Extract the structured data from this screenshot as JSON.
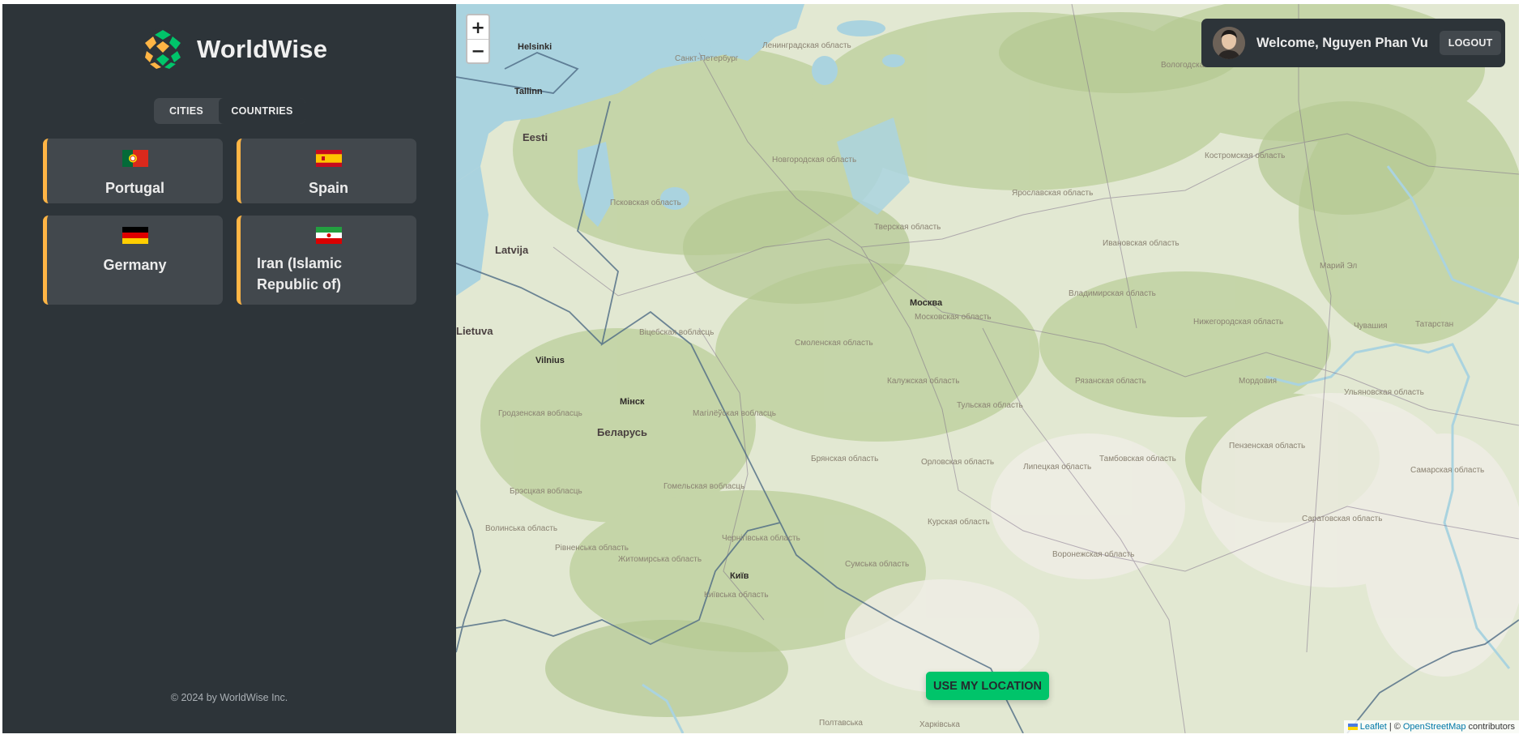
{
  "app": {
    "name": "WorldWise",
    "footer": "© 2024 by WorldWise Inc."
  },
  "tabs": [
    {
      "label": "CITIES",
      "active": false
    },
    {
      "label": "COUNTRIES",
      "active": true
    }
  ],
  "countries": [
    {
      "name": "Portugal",
      "flag": "portugal-flag-icon"
    },
    {
      "name": "Spain",
      "flag": "spain-flag-icon"
    },
    {
      "name": "Germany",
      "flag": "germany-flag-icon"
    },
    {
      "name": "Iran (Islamic Republic of)",
      "flag": "iran-flag-icon"
    }
  ],
  "user": {
    "welcome": "Welcome, Nguyen Phan Vu",
    "logout_label": "LOGOUT"
  },
  "map": {
    "zoom_in": "+",
    "zoom_out": "−",
    "location_button": "USE MY LOCATION",
    "attribution": {
      "leaflet": "Leaflet",
      "separator": "| ©",
      "osm": "OpenStreetMap",
      "suffix": "contributors"
    },
    "labels": {
      "helsinki": "Helsinki",
      "tallinn": "Tallinn",
      "eesti": "Eesti",
      "latvija": "Latvija",
      "lietuva": "Lietuva",
      "vilnius": "Vilnius",
      "minsk": "Мінск",
      "belarus": "Беларусь",
      "moskva": "Москва",
      "kyiv": "Київ",
      "spb": "Санкт-Петербург",
      "leningrad": "Ленинградская область",
      "pskov": "Псковская область",
      "novgorod": "Новгородская область",
      "tver": "Тверская область",
      "yaroslavl": "Ярославская область",
      "kostroma": "Костромская область",
      "vologda": "Вологодская область",
      "ivanovo": "Ивановская область",
      "vladimir": "Владимирская область",
      "moscow_obl": "Московская область",
      "smolensk": "Смоленская область",
      "kaluga": "Калужская область",
      "tula": "Тульская область",
      "ryazan": "Рязанская область",
      "nizhny": "Нижегородская область",
      "mari": "Марий Эл",
      "chuvash": "Чувашия",
      "tatarstan": "Татарстан",
      "mordovia": "Мордовия",
      "ulyanovsk": "Ульяновская область",
      "penza": "Пензенская область",
      "samara": "Самарская область",
      "saratov": "Саратовская область",
      "tambov": "Тамбовская область",
      "lipetsk": "Липецкая область",
      "orel": "Орловская область",
      "bryansk": "Брянская область",
      "kursk": "Курская область",
      "voronezh": "Воронежская область",
      "vitebsk": "Віцебская вобласць",
      "grodno": "Гродзенская вобласць",
      "mogilev": "Магілёўская вобласць",
      "brest": "Брэсцкая вобласць",
      "gomel": "Гомельская вобласць",
      "volyn": "Волинська область",
      "rivne": "Рівненська область",
      "zhytomyr": "Житомирська область",
      "chernihiv": "Чернігівська область",
      "sumy": "Сумська область",
      "kyiv_obl": "Київська область",
      "poltava": "Полтавська",
      "kharkiv": "Харківська"
    }
  },
  "colors": {
    "sidebar_bg": "#2d3439",
    "card_bg": "#42484d",
    "accent_orange": "#ffb545",
    "accent_green": "#00c46a",
    "map_water": "#aad3df",
    "map_forest": "#c7d7ac"
  }
}
